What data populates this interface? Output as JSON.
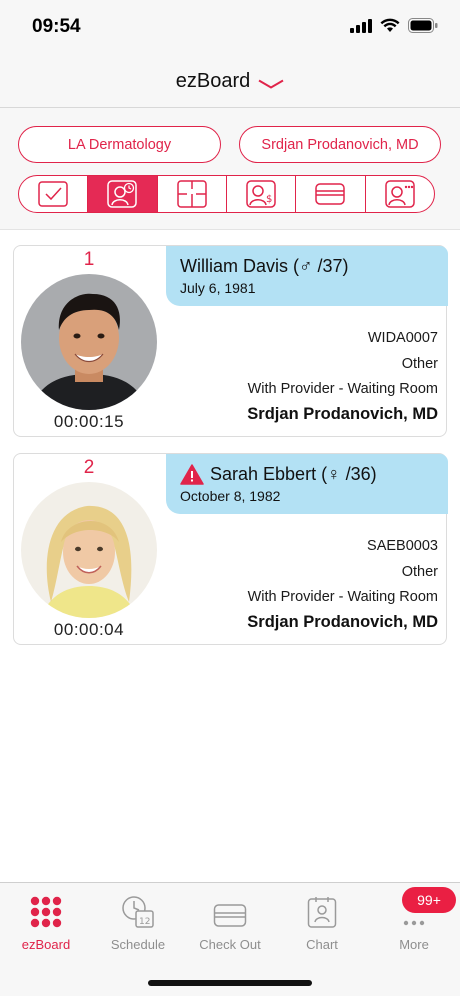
{
  "status_bar": {
    "time": "09:54"
  },
  "header": {
    "title": "ezBoard"
  },
  "filters": {
    "location": "LA Dermatology",
    "provider": "Srdjan Prodanovich, MD"
  },
  "view_tabs": [
    {
      "name": "checked-in-view",
      "icon": "check-icon"
    },
    {
      "name": "with-provider-view",
      "icon": "person-clock-icon",
      "active": true
    },
    {
      "name": "room-view",
      "icon": "room-layout-icon"
    },
    {
      "name": "checkout-person-view",
      "icon": "person-dollar-icon"
    },
    {
      "name": "payment-view",
      "icon": "card-icon"
    },
    {
      "name": "more-person-view",
      "icon": "person-more-icon"
    }
  ],
  "patients": [
    {
      "index": "1",
      "name": "William Davis (",
      "gender_symbol": "♂",
      "age": " /37)",
      "dob": "July 6, 1981",
      "id": "WIDA0007",
      "type": "Other",
      "status": "With Provider - Waiting Room",
      "provider": "Srdjan Prodanovich, MD",
      "timer": "00:00:15",
      "alert": false
    },
    {
      "index": "2",
      "name": "Sarah Ebbert (",
      "gender_symbol": "♀",
      "age": " /36)",
      "dob": "October 8, 1982",
      "id": "SAEB0003",
      "type": "Other",
      "status": "With Provider - Waiting Room",
      "provider": "Srdjan Prodanovich, MD",
      "timer": "00:00:04",
      "alert": true
    }
  ],
  "tab_bar": {
    "items": [
      {
        "label": "ezBoard",
        "icon": "grid-dots-icon",
        "active": true
      },
      {
        "label": "Schedule",
        "icon": "calendar-clock-icon"
      },
      {
        "label": "Check Out",
        "icon": "card-icon"
      },
      {
        "label": "Chart",
        "icon": "chart-icon"
      },
      {
        "label": "More",
        "icon": "more-dots-icon"
      }
    ],
    "badge": "99+"
  },
  "colors": {
    "accent": "#e0244a",
    "banner": "#b3e1f4"
  }
}
